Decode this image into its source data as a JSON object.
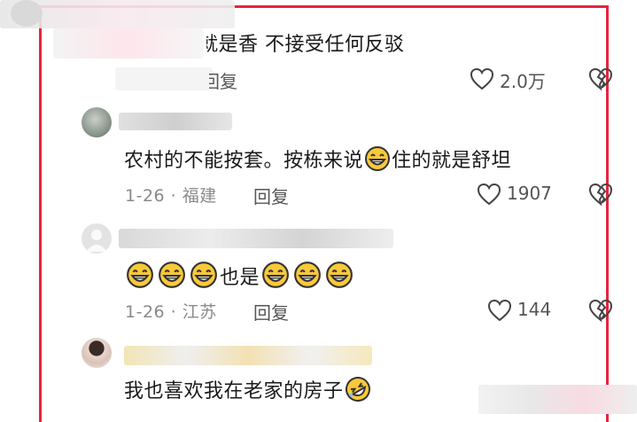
{
  "comments": [
    {
      "text": "就是香 不接受任何反驳",
      "reply_label": "回复",
      "likes": "2.0万"
    },
    {
      "text_before": "农村的不能按套。按栋来说",
      "text_after": "住的就是舒坦",
      "emoji": "grinning-face",
      "date_location": "1-26 · 福建",
      "reply_label": "回复",
      "likes": "1907"
    },
    {
      "text_middle": "也是",
      "emoji": "grinning-face",
      "date_location": "1-26 · 江苏",
      "reply_label": "回复",
      "likes": "144"
    },
    {
      "text": "我也喜欢我在老家的房子",
      "emoji": "rolling-on-floor-laughing"
    }
  ],
  "colors": {
    "frame": "#e8233f",
    "emoji_face": "#f9c93a",
    "icon_stroke": "#444444"
  }
}
